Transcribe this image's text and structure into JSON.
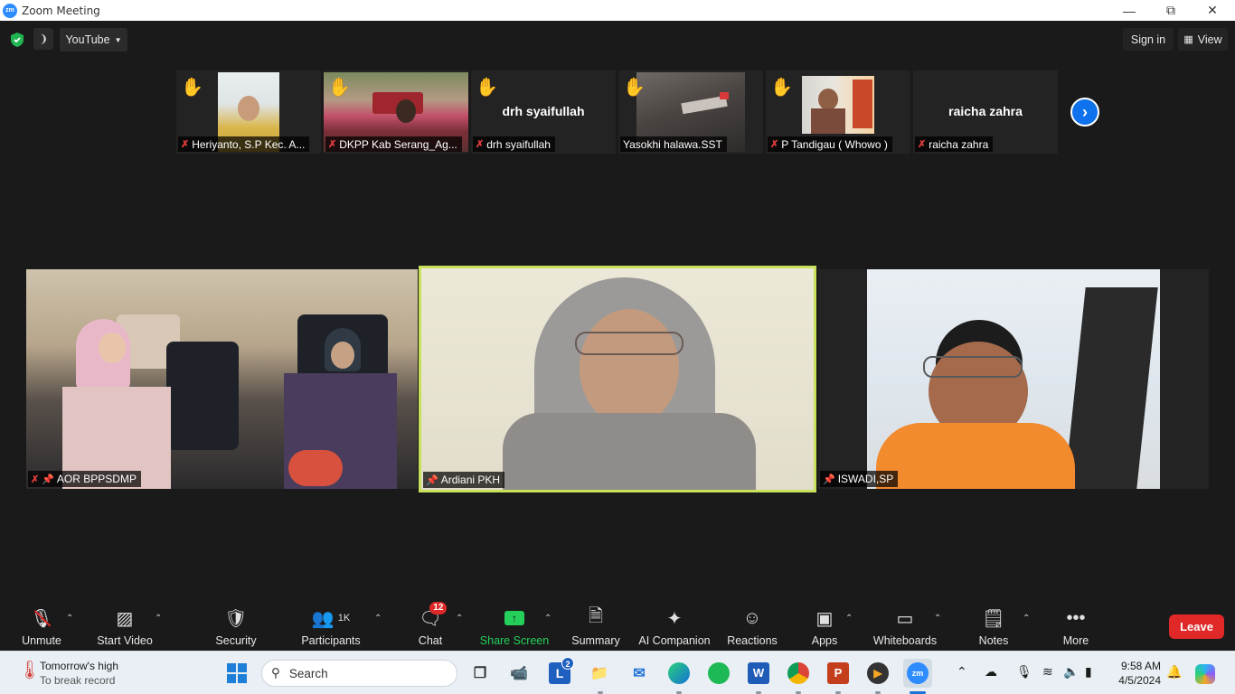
{
  "window": {
    "title": "Zoom Meeting",
    "app_icon": "zm"
  },
  "topbar": {
    "stream_label": "YouTube",
    "signin_label": "Sign in",
    "view_label": "View"
  },
  "strip": [
    {
      "name": "Heriyanto, S.P Kec. A...",
      "hand_raised": true,
      "muted": true
    },
    {
      "name": "DKPP Kab Serang_Ag...",
      "hand_raised": true,
      "muted": true
    },
    {
      "name": "drh syaifullah",
      "hand_raised": true,
      "muted": true,
      "display_name": "drh syaifullah"
    },
    {
      "name": "Yasokhi halawa.SST",
      "hand_raised": true,
      "muted": false
    },
    {
      "name": "P Tandigau ( Whowo )",
      "hand_raised": true,
      "muted": true
    },
    {
      "name": "raicha zahra",
      "hand_raised": false,
      "muted": true,
      "display_name": "raicha zahra"
    }
  ],
  "main_tiles": [
    {
      "name": "AOR BPPSDMP",
      "muted": true,
      "pinned": true
    },
    {
      "name": "Ardiani PKH",
      "muted": false,
      "pinned": true,
      "active_speaker": true
    },
    {
      "name": "ISWADI,SP",
      "muted": false,
      "pinned": true
    }
  ],
  "toolbar": {
    "unmute": "Unmute",
    "start_video": "Start Video",
    "security": "Security",
    "participants": "Participants",
    "participants_count": "1K",
    "chat": "Chat",
    "chat_badge": "12",
    "share_screen": "Share Screen",
    "summary": "Summary",
    "ai_companion": "AI Companion",
    "reactions": "Reactions",
    "apps": "Apps",
    "whiteboards": "Whiteboards",
    "notes": "Notes",
    "more": "More",
    "leave": "Leave"
  },
  "taskbar": {
    "weather_title": "Tomorrow's high",
    "weather_sub": "To break record",
    "search_placeholder": "Search",
    "time": "9:58 AM",
    "date": "4/5/2024",
    "lens_badge": "2"
  },
  "colors": {
    "accent_blue": "#0e72ed",
    "share_green": "#24d05a",
    "leave_red": "#e02828",
    "hand_yellow": "#f2c200",
    "speaker_border": "#c8e05a"
  }
}
